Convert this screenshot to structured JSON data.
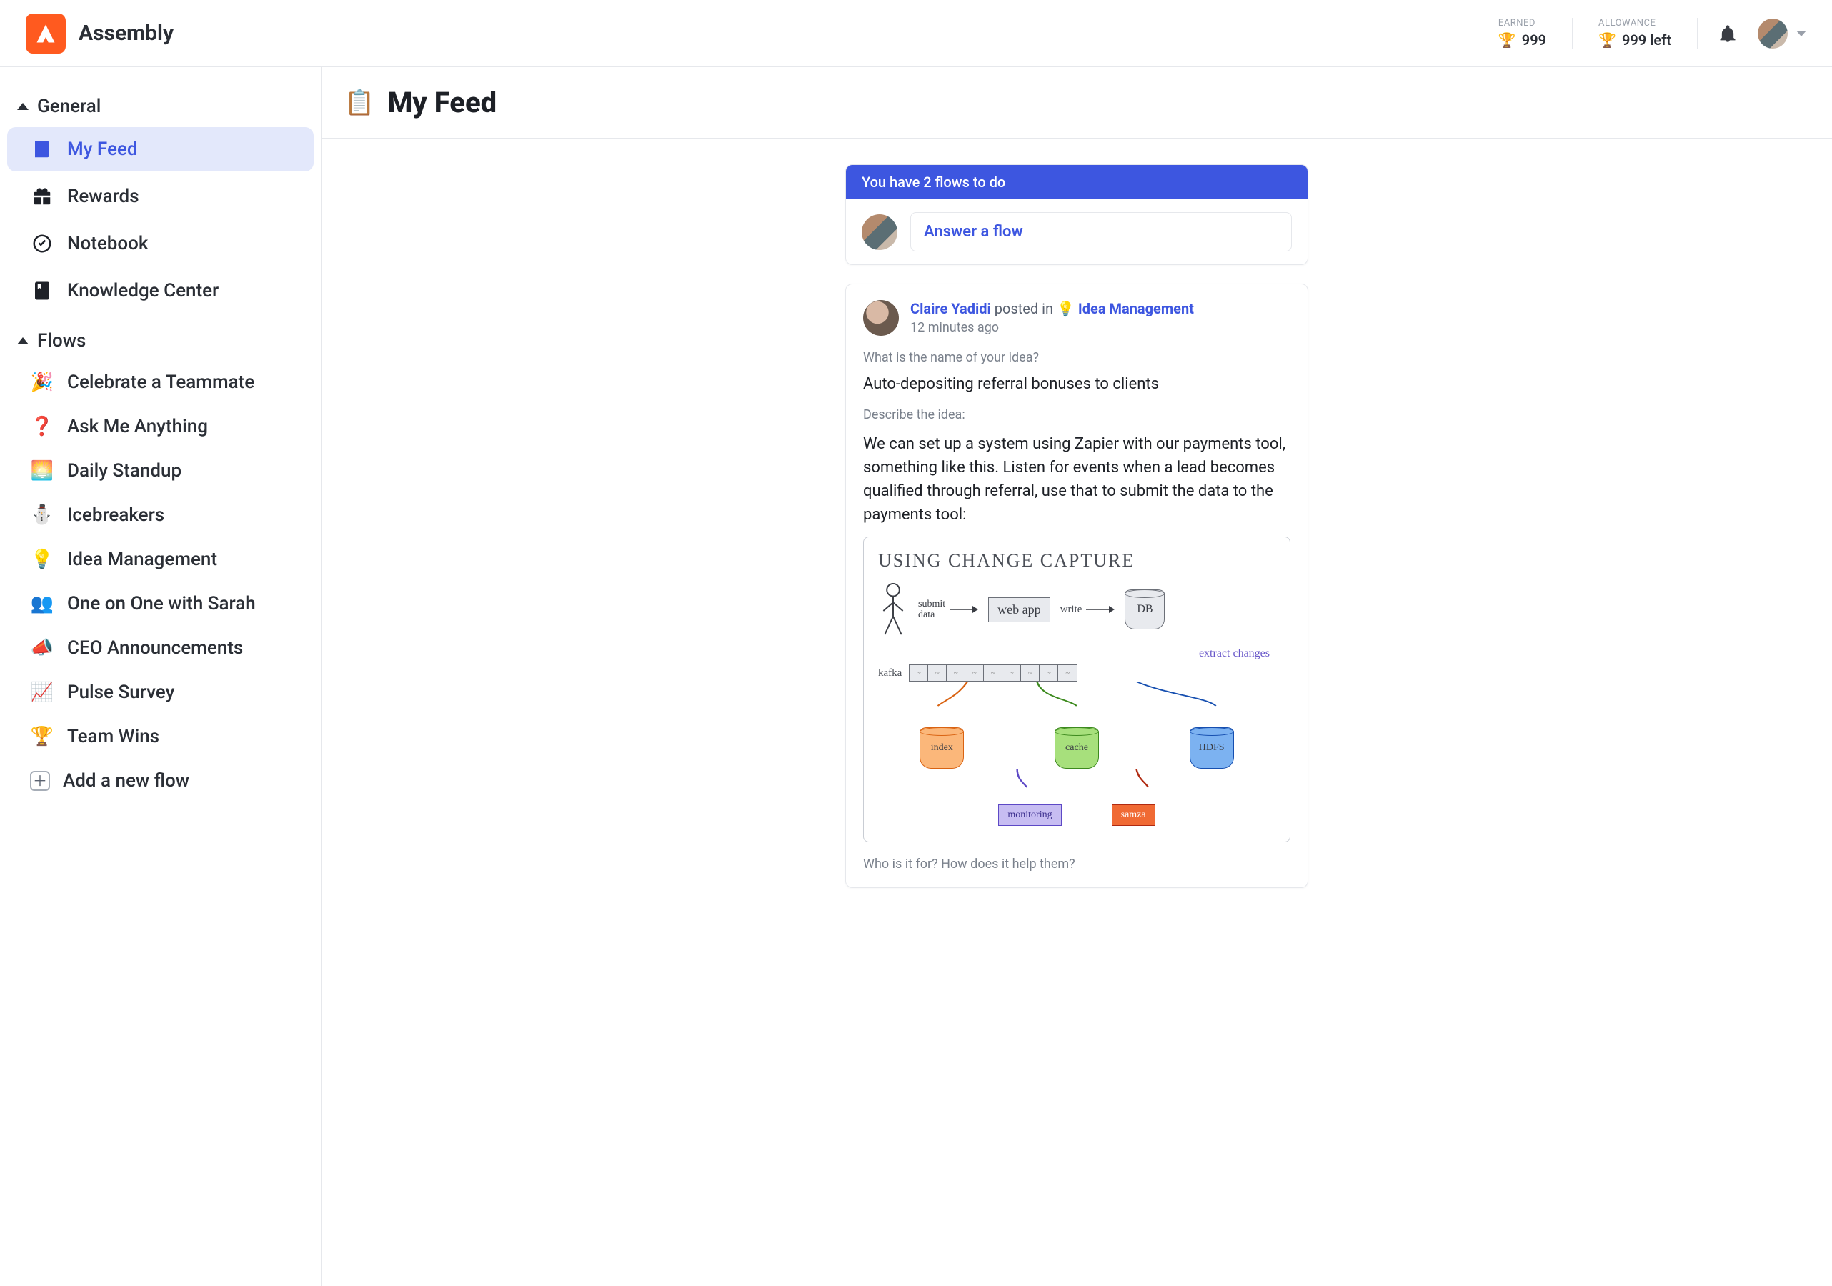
{
  "brand": {
    "name": "Assembly"
  },
  "topbar": {
    "earned": {
      "label": "EARNED",
      "value": "999"
    },
    "allowance": {
      "label": "ALLOWANCE",
      "value": "999 left"
    }
  },
  "sidebar": {
    "sections": {
      "general": {
        "label": "General",
        "items": {
          "my_feed": "My Feed",
          "rewards": "Rewards",
          "notebook": "Notebook",
          "knowledge_center": "Knowledge Center"
        }
      },
      "flows": {
        "label": "Flows",
        "items": {
          "celebrate": "Celebrate a Teammate",
          "ama": "Ask Me Anything",
          "standup": "Daily Standup",
          "icebreakers": "Icebreakers",
          "idea_mgmt": "Idea Management",
          "one_on_one": "One on One with Sarah",
          "ceo_ann": "CEO Announcements",
          "pulse": "Pulse Survey",
          "team_wins": "Team Wins"
        },
        "add_label": "Add a new flow"
      }
    }
  },
  "page": {
    "title": "My Feed"
  },
  "todo": {
    "header": "You have 2 flows to do",
    "cta": "Answer a flow"
  },
  "post": {
    "author": "Claire Yadidi",
    "posted_in": " posted in ",
    "flow_emoji": "💡",
    "flow_name": "Idea Management",
    "timestamp": "12 minutes ago",
    "q1_label": "What is the name of your idea?",
    "q1_answer": "Auto-depositing referral bonuses to clients",
    "q2_label": "Describe the idea:",
    "q2_answer": "We can set up a system using Zapier with our payments tool, something like this. Listen for events when a lead becomes qualified through referral, use that to submit the data to the payments tool:",
    "q3_label": "Who is it for? How does it help them?"
  },
  "diagram": {
    "title": "USING CHANGE CAPTURE",
    "submit_label_1": "submit",
    "submit_label_2": "data",
    "webapp": "web app",
    "write_label": "write",
    "db": "DB",
    "extract": "extract changes",
    "kafka": "kafka",
    "index": "index",
    "cache": "cache",
    "hdfs": "HDFS",
    "monitoring": "monitoring",
    "samza": "samza"
  },
  "flow_emojis": {
    "celebrate": "🎉",
    "ama": "❓",
    "standup": "🌅",
    "icebreakers": "⛄",
    "idea_mgmt": "💡",
    "one_on_one": "👥",
    "ceo_ann": "📣",
    "pulse": "📈",
    "team_wins": "🏆"
  }
}
